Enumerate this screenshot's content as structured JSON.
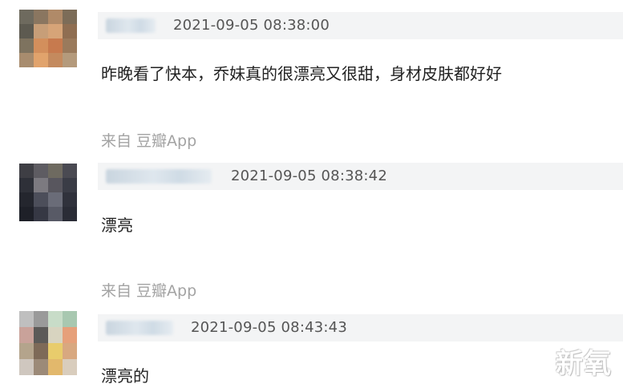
{
  "comments": [
    {
      "timestamp": "2021-09-05 08:38:00",
      "text": "昨晚看了快本，乔妹真的很漂亮又很甜，身材皮肤都好好",
      "source": "来自 豆瓣App"
    },
    {
      "timestamp": "2021-09-05 08:38:42",
      "text": "漂亮",
      "source": "来自 豆瓣App"
    },
    {
      "timestamp": "2021-09-05 08:43:43",
      "text": "漂亮的"
    }
  ],
  "watermark": "新氧",
  "colors": {
    "meta_bar": "#f3f4f5",
    "timestamp": "#555555",
    "source": "#a3a3a3"
  }
}
